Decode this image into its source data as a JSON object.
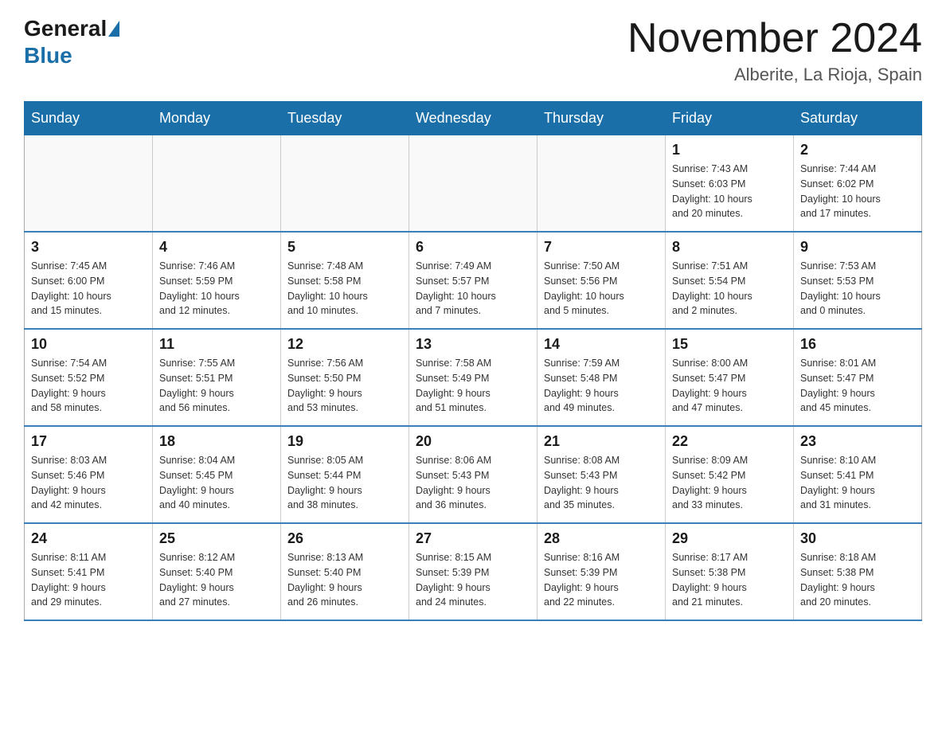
{
  "header": {
    "logo_general": "General",
    "logo_blue": "Blue",
    "month_title": "November 2024",
    "location": "Alberite, La Rioja, Spain"
  },
  "weekdays": [
    "Sunday",
    "Monday",
    "Tuesday",
    "Wednesday",
    "Thursday",
    "Friday",
    "Saturday"
  ],
  "weeks": [
    [
      {
        "day": "",
        "info": ""
      },
      {
        "day": "",
        "info": ""
      },
      {
        "day": "",
        "info": ""
      },
      {
        "day": "",
        "info": ""
      },
      {
        "day": "",
        "info": ""
      },
      {
        "day": "1",
        "info": "Sunrise: 7:43 AM\nSunset: 6:03 PM\nDaylight: 10 hours\nand 20 minutes."
      },
      {
        "day": "2",
        "info": "Sunrise: 7:44 AM\nSunset: 6:02 PM\nDaylight: 10 hours\nand 17 minutes."
      }
    ],
    [
      {
        "day": "3",
        "info": "Sunrise: 7:45 AM\nSunset: 6:00 PM\nDaylight: 10 hours\nand 15 minutes."
      },
      {
        "day": "4",
        "info": "Sunrise: 7:46 AM\nSunset: 5:59 PM\nDaylight: 10 hours\nand 12 minutes."
      },
      {
        "day": "5",
        "info": "Sunrise: 7:48 AM\nSunset: 5:58 PM\nDaylight: 10 hours\nand 10 minutes."
      },
      {
        "day": "6",
        "info": "Sunrise: 7:49 AM\nSunset: 5:57 PM\nDaylight: 10 hours\nand 7 minutes."
      },
      {
        "day": "7",
        "info": "Sunrise: 7:50 AM\nSunset: 5:56 PM\nDaylight: 10 hours\nand 5 minutes."
      },
      {
        "day": "8",
        "info": "Sunrise: 7:51 AM\nSunset: 5:54 PM\nDaylight: 10 hours\nand 2 minutes."
      },
      {
        "day": "9",
        "info": "Sunrise: 7:53 AM\nSunset: 5:53 PM\nDaylight: 10 hours\nand 0 minutes."
      }
    ],
    [
      {
        "day": "10",
        "info": "Sunrise: 7:54 AM\nSunset: 5:52 PM\nDaylight: 9 hours\nand 58 minutes."
      },
      {
        "day": "11",
        "info": "Sunrise: 7:55 AM\nSunset: 5:51 PM\nDaylight: 9 hours\nand 56 minutes."
      },
      {
        "day": "12",
        "info": "Sunrise: 7:56 AM\nSunset: 5:50 PM\nDaylight: 9 hours\nand 53 minutes."
      },
      {
        "day": "13",
        "info": "Sunrise: 7:58 AM\nSunset: 5:49 PM\nDaylight: 9 hours\nand 51 minutes."
      },
      {
        "day": "14",
        "info": "Sunrise: 7:59 AM\nSunset: 5:48 PM\nDaylight: 9 hours\nand 49 minutes."
      },
      {
        "day": "15",
        "info": "Sunrise: 8:00 AM\nSunset: 5:47 PM\nDaylight: 9 hours\nand 47 minutes."
      },
      {
        "day": "16",
        "info": "Sunrise: 8:01 AM\nSunset: 5:47 PM\nDaylight: 9 hours\nand 45 minutes."
      }
    ],
    [
      {
        "day": "17",
        "info": "Sunrise: 8:03 AM\nSunset: 5:46 PM\nDaylight: 9 hours\nand 42 minutes."
      },
      {
        "day": "18",
        "info": "Sunrise: 8:04 AM\nSunset: 5:45 PM\nDaylight: 9 hours\nand 40 minutes."
      },
      {
        "day": "19",
        "info": "Sunrise: 8:05 AM\nSunset: 5:44 PM\nDaylight: 9 hours\nand 38 minutes."
      },
      {
        "day": "20",
        "info": "Sunrise: 8:06 AM\nSunset: 5:43 PM\nDaylight: 9 hours\nand 36 minutes."
      },
      {
        "day": "21",
        "info": "Sunrise: 8:08 AM\nSunset: 5:43 PM\nDaylight: 9 hours\nand 35 minutes."
      },
      {
        "day": "22",
        "info": "Sunrise: 8:09 AM\nSunset: 5:42 PM\nDaylight: 9 hours\nand 33 minutes."
      },
      {
        "day": "23",
        "info": "Sunrise: 8:10 AM\nSunset: 5:41 PM\nDaylight: 9 hours\nand 31 minutes."
      }
    ],
    [
      {
        "day": "24",
        "info": "Sunrise: 8:11 AM\nSunset: 5:41 PM\nDaylight: 9 hours\nand 29 minutes."
      },
      {
        "day": "25",
        "info": "Sunrise: 8:12 AM\nSunset: 5:40 PM\nDaylight: 9 hours\nand 27 minutes."
      },
      {
        "day": "26",
        "info": "Sunrise: 8:13 AM\nSunset: 5:40 PM\nDaylight: 9 hours\nand 26 minutes."
      },
      {
        "day": "27",
        "info": "Sunrise: 8:15 AM\nSunset: 5:39 PM\nDaylight: 9 hours\nand 24 minutes."
      },
      {
        "day": "28",
        "info": "Sunrise: 8:16 AM\nSunset: 5:39 PM\nDaylight: 9 hours\nand 22 minutes."
      },
      {
        "day": "29",
        "info": "Sunrise: 8:17 AM\nSunset: 5:38 PM\nDaylight: 9 hours\nand 21 minutes."
      },
      {
        "day": "30",
        "info": "Sunrise: 8:18 AM\nSunset: 5:38 PM\nDaylight: 9 hours\nand 20 minutes."
      }
    ]
  ]
}
